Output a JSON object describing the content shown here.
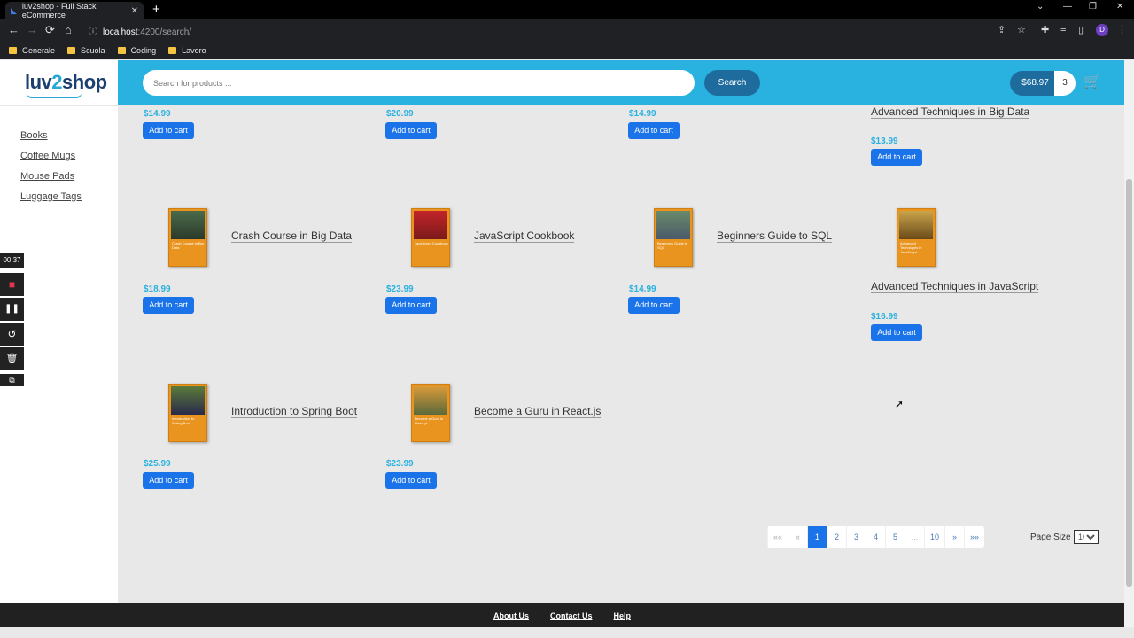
{
  "browser": {
    "tab_title": "luv2shop - Full Stack eCommerce",
    "tab_close": "✕",
    "new_tab": "+",
    "url_host": "localhost",
    "url_path": ":4200/search/",
    "bookmarks": [
      "Generale",
      "Scuola",
      "Coding",
      "Lavoro"
    ]
  },
  "logo": {
    "part1": "luv",
    "part2": "2",
    "part3": "shop"
  },
  "categories": [
    "Books",
    "Coffee Mugs",
    "Mouse Pads",
    "Luggage Tags"
  ],
  "search": {
    "placeholder": "Search for products ...",
    "button": "Search"
  },
  "cart": {
    "total": "$68.97",
    "quantity": "3"
  },
  "add_label": "Add to cart",
  "products": [
    {
      "name": "",
      "price": "$14.99"
    },
    {
      "name": "",
      "price": "$20.99"
    },
    {
      "name": "",
      "price": "$14.99"
    },
    {
      "name": "Advanced Techniques in Big Data",
      "price": "$13.99"
    },
    {
      "name": "Crash Course in Big Data",
      "price": "$18.99",
      "cover": "Crash Course in Big Data"
    },
    {
      "name": "JavaScript Cookbook",
      "price": "$23.99",
      "cover": "JavaScript Cookbook"
    },
    {
      "name": "Beginners Guide to SQL",
      "price": "$14.99",
      "cover": "Beginners Guide to SQL"
    },
    {
      "name": "Advanced Techniques in JavaScript",
      "price": "$16.99",
      "cover": "Advanced Techniques in JavaScript"
    },
    {
      "name": "Introduction to Spring Boot",
      "price": "$25.99",
      "cover": "Introduction to Spring Boot"
    },
    {
      "name": "Become a Guru in React.js",
      "price": "$23.99",
      "cover": "Become a Guru in React.js"
    }
  ],
  "pagination": {
    "first": "««",
    "prev": "«",
    "pages": [
      "1",
      "2",
      "3",
      "4",
      "5",
      "...",
      "10"
    ],
    "next": "»",
    "last": "»»",
    "active": "1",
    "page_size_label": "Page Size",
    "page_size_value": "10"
  },
  "footer": [
    "About Us",
    "Contact Us",
    "Help"
  ],
  "recorder": {
    "time": "00:37"
  },
  "colors": {
    "header": "#29b1e0",
    "button": "#1a73e8",
    "price": "#29b1e0",
    "footer": "#212121"
  }
}
